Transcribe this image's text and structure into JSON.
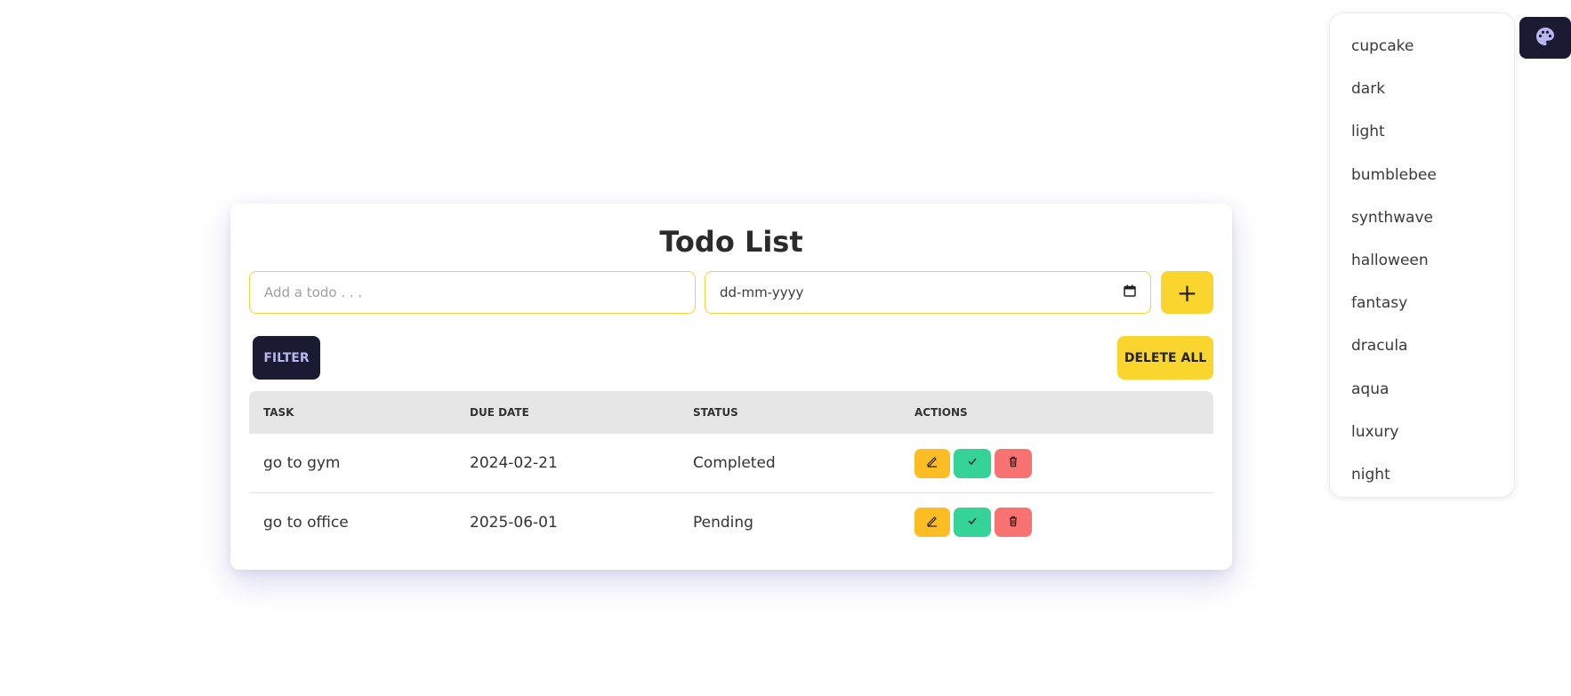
{
  "theme_menu": {
    "items": [
      "cupcake",
      "dark",
      "light",
      "bumblebee",
      "synthwave",
      "halloween",
      "fantasy",
      "dracula",
      "aqua",
      "luxury",
      "night"
    ]
  },
  "theme_toggle": {
    "icon": "palette-icon"
  },
  "app": {
    "title": "Todo List",
    "todo_input": {
      "placeholder": "Add a todo . . .",
      "value": ""
    },
    "date_input": {
      "placeholder": "dd-mm-yyyy",
      "value": ""
    },
    "add_button": {
      "label": "+"
    },
    "filter_button": {
      "label": "FILTER"
    },
    "delete_all_button": {
      "label": "DELETE ALL"
    }
  },
  "table": {
    "headers": [
      "TASK",
      "DUE DATE",
      "STATUS",
      "ACTIONS"
    ],
    "rows": [
      {
        "task": "go to gym",
        "due_date": "2024-02-21",
        "status": "Completed"
      },
      {
        "task": "go to office",
        "due_date": "2025-06-01",
        "status": "Pending"
      }
    ]
  },
  "colors": {
    "accent": "#fad52d",
    "dark": "#1a1b33",
    "edit": "#fbbd23",
    "done": "#36d399",
    "delete": "#f87272"
  }
}
